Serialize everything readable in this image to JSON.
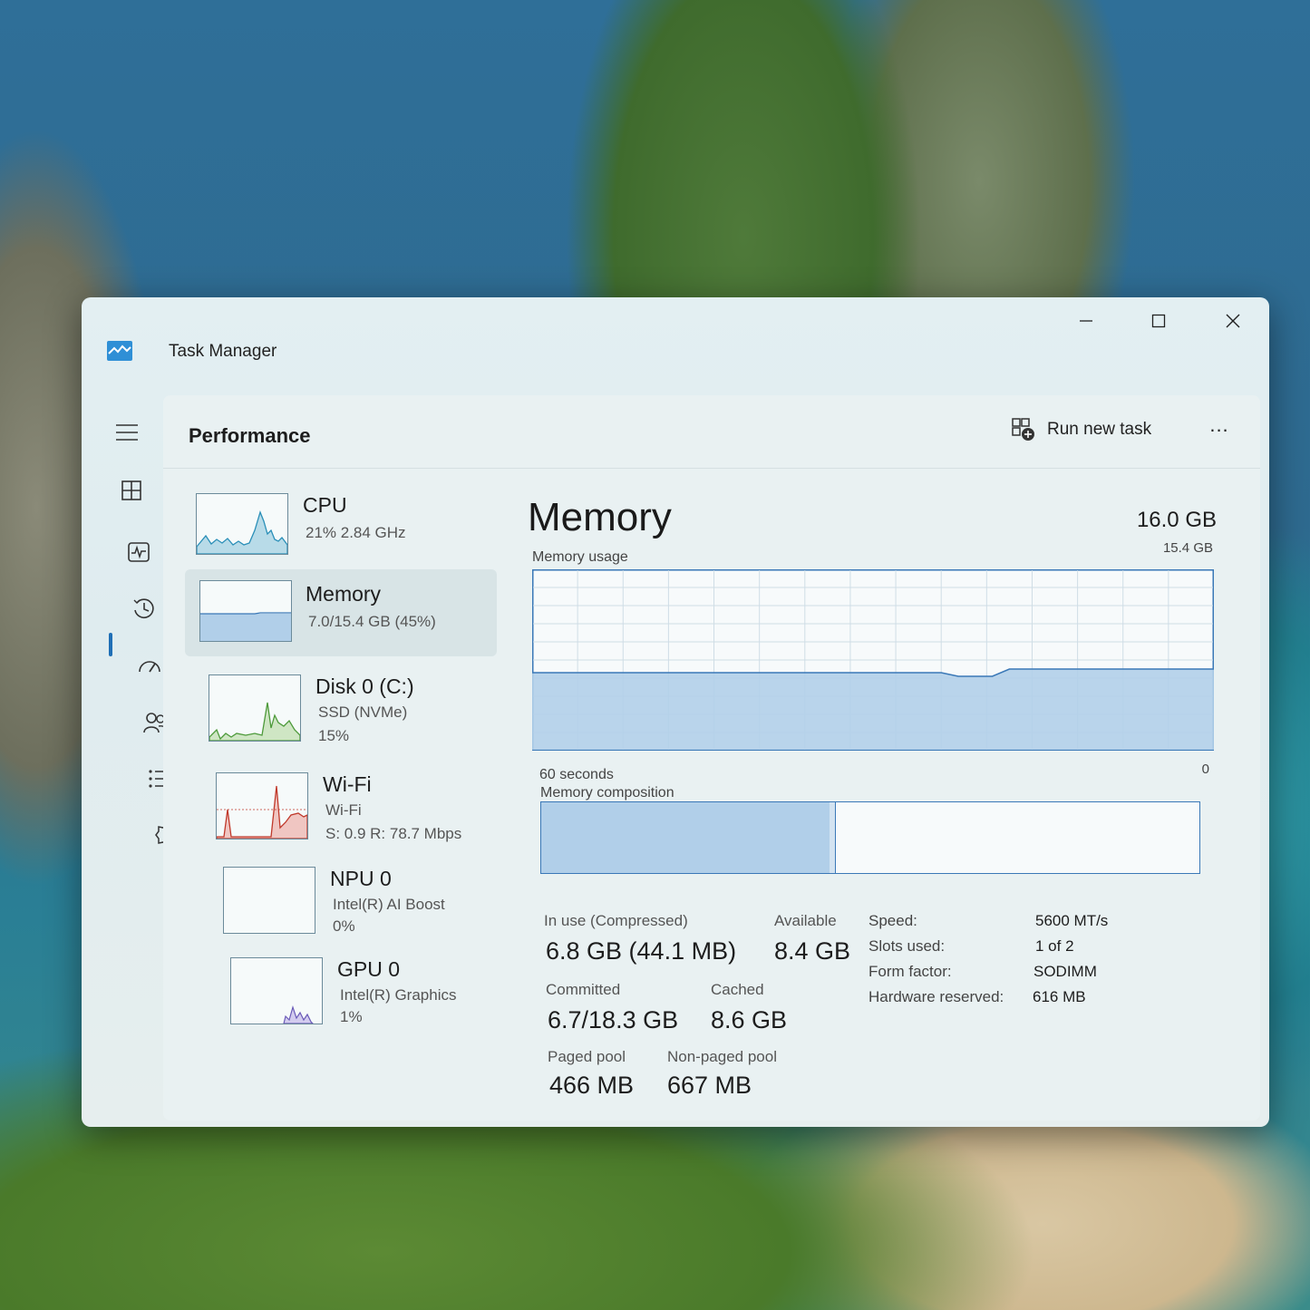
{
  "window": {
    "title": "Task Manager"
  },
  "header": {
    "page_title": "Performance",
    "run_new_task": "Run new task",
    "more": "..."
  },
  "devices": [
    {
      "name": "CPU",
      "lines": [
        "21%  2.84 GHz"
      ]
    },
    {
      "name": "Memory",
      "lines": [
        "7.0/15.4 GB (45%)"
      ]
    },
    {
      "name": "Disk 0 (C:)",
      "lines": [
        "SSD (NVMe)",
        "15%"
      ]
    },
    {
      "name": "Wi-Fi",
      "lines": [
        "Wi-Fi",
        "S: 0.9  R: 78.7 Mbps"
      ]
    },
    {
      "name": "NPU 0",
      "lines": [
        "Intel(R) AI Boost",
        "0%"
      ]
    },
    {
      "name": "GPU 0",
      "lines": [
        "Intel(R) Graphics",
        "1%"
      ]
    }
  ],
  "memory": {
    "title": "Memory",
    "total": "16.0 GB",
    "usage_label": "Memory usage",
    "usage_max": "15.4 GB",
    "time_label": "60 seconds",
    "zero_label": "0",
    "composition_label": "Memory composition",
    "usage_fraction": 0.45,
    "in_use_label": "In use (Compressed)",
    "in_use_value": "6.8 GB (44.1 MB)",
    "available_label": "Available",
    "available_value": "8.4 GB",
    "committed_label": "Committed",
    "committed_value": "6.7/18.3 GB",
    "cached_label": "Cached",
    "cached_value": "8.6 GB",
    "paged_label": "Paged pool",
    "paged_value": "466 MB",
    "nonpaged_label": "Non-paged pool",
    "nonpaged_value": "667 MB",
    "specs": [
      {
        "label": "Speed:",
        "value": "5600 MT/s"
      },
      {
        "label": "Slots used:",
        "value": "1 of 2"
      },
      {
        "label": "Form factor:",
        "value": "SODIMM"
      },
      {
        "label": "Hardware reserved:",
        "value": "616 MB"
      }
    ]
  },
  "icons": {
    "app": "task-manager-icon",
    "nav": [
      "hamburger-icon",
      "processes-icon",
      "performance-icon",
      "app-history-icon",
      "startup-apps-icon",
      "users-icon",
      "details-icon",
      "services-icon",
      "settings-icon"
    ]
  },
  "colors": {
    "accent": "#1f6fb6",
    "memory_fill": "#b1cfe9",
    "memory_line": "#3a78b7",
    "cpu_line": "#2a8fb8",
    "disk_line": "#4d9a3a",
    "wifi_line": "#c0392b",
    "gpu_line": "#6b5bb8"
  }
}
